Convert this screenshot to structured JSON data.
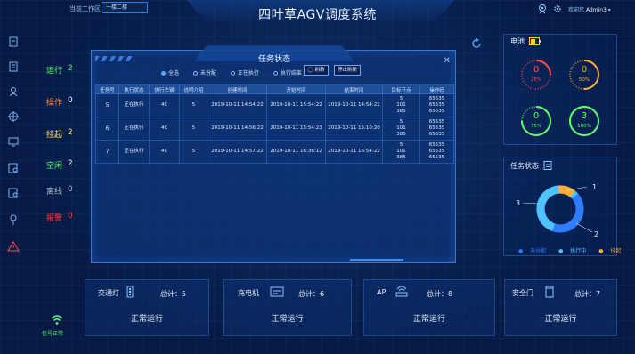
{
  "header": {
    "zone_label": "当前工作区：",
    "zone_value": "一楼二楼",
    "title": "四叶草AGV调度系统",
    "welcome_label": "欢迎您",
    "username": "Admin3"
  },
  "status_list": [
    {
      "label": "运行",
      "value": "2",
      "color": "#5dff6a"
    },
    {
      "label": "操作",
      "value": "0",
      "color": "#ff8a3d"
    },
    {
      "label": "挂起",
      "value": "2",
      "color": "#ffe14a"
    },
    {
      "label": "空闲",
      "value": "2",
      "color": "#5dff6a"
    },
    {
      "label": "离线",
      "value": "0",
      "color": "#a8b6c8"
    },
    {
      "label": "报警",
      "value": "0",
      "color": "#ff3b3b"
    }
  ],
  "modal": {
    "title": "任务状态",
    "filters": [
      {
        "label": "全选",
        "selected": true
      },
      {
        "label": "未分配",
        "selected": false
      },
      {
        "label": "正在执行",
        "selected": false
      },
      {
        "label": "执行结束",
        "selected": false
      }
    ],
    "refresh_label": "刷新",
    "stop_refresh_label": "停止刷新",
    "columns": [
      "任务号",
      "执行状态",
      "执行车辆",
      "说明介绍",
      "创建时间",
      "开始时间",
      "结束时间",
      "目标节点",
      "操作码"
    ],
    "rows": [
      {
        "id": "5",
        "status": "正在执行",
        "vehicle": "40",
        "desc": "5",
        "created": "2019-10-11 14:54:22",
        "start": "2019-10-11 15:54:22",
        "end": "2019-10-11 14:54:22",
        "target": [
          "5",
          "101",
          "385"
        ],
        "codes": [
          "65535",
          "65535",
          "65535"
        ]
      },
      {
        "id": "6",
        "status": "正在执行",
        "vehicle": "40",
        "desc": "5",
        "created": "2019-10-11 14:56:22",
        "start": "2019-10-11 15:54:23",
        "end": "2019-10-11 15:10:20",
        "target": [
          "5",
          "101",
          "385"
        ],
        "codes": [
          "65535",
          "65535",
          "65535"
        ]
      },
      {
        "id": "7",
        "status": "正在执行",
        "vehicle": "40",
        "desc": "5",
        "created": "2019-10-11 14:57:22",
        "start": "2019-10-11 16:36:12",
        "end": "2019-10-11 16:54:22",
        "target": [
          "5",
          "101",
          "385"
        ],
        "codes": [
          "65535",
          "65535",
          "65535"
        ]
      }
    ]
  },
  "battery": {
    "title": "电池",
    "gauges": [
      {
        "value": "0",
        "percent_label": "25%",
        "percent": 25,
        "color": "#ff4a4a"
      },
      {
        "value": "0",
        "percent_label": "50%",
        "percent": 50,
        "color": "#ffb02e"
      },
      {
        "value": "0",
        "percent_label": "75%",
        "percent": 75,
        "color": "#5dff6a"
      },
      {
        "value": "3",
        "percent_label": "100%",
        "percent": 100,
        "color": "#5dff6a"
      }
    ]
  },
  "task_status": {
    "title": "任务状态",
    "donut": {
      "segments": [
        {
          "name": "未分配",
          "value": 0,
          "color": "#2f7dff"
        },
        {
          "name": "执行中",
          "value": 3,
          "color": "#4fc3ff"
        },
        {
          "name": "挂起",
          "value": 1,
          "color": "#ffb02e"
        }
      ],
      "label_top": "1",
      "label_left": "3",
      "label_bottom": "2"
    },
    "legend": [
      {
        "label": "未分配",
        "color": "#2f7dff"
      },
      {
        "label": "执行中",
        "color": "#4fc3ff"
      },
      {
        "label": "挂起",
        "color": "#ffb02e"
      }
    ]
  },
  "cards": [
    {
      "name": "交通灯",
      "total": "总计：5",
      "status": "正常运行"
    },
    {
      "name": "充电机",
      "total": "总计：6",
      "status": "正常运行"
    },
    {
      "name": "AP",
      "total": "总计：8",
      "status": "正常运行"
    },
    {
      "name": "安全门",
      "total": "总计：7",
      "status": "正常运行"
    }
  ],
  "signal": "信号正常"
}
